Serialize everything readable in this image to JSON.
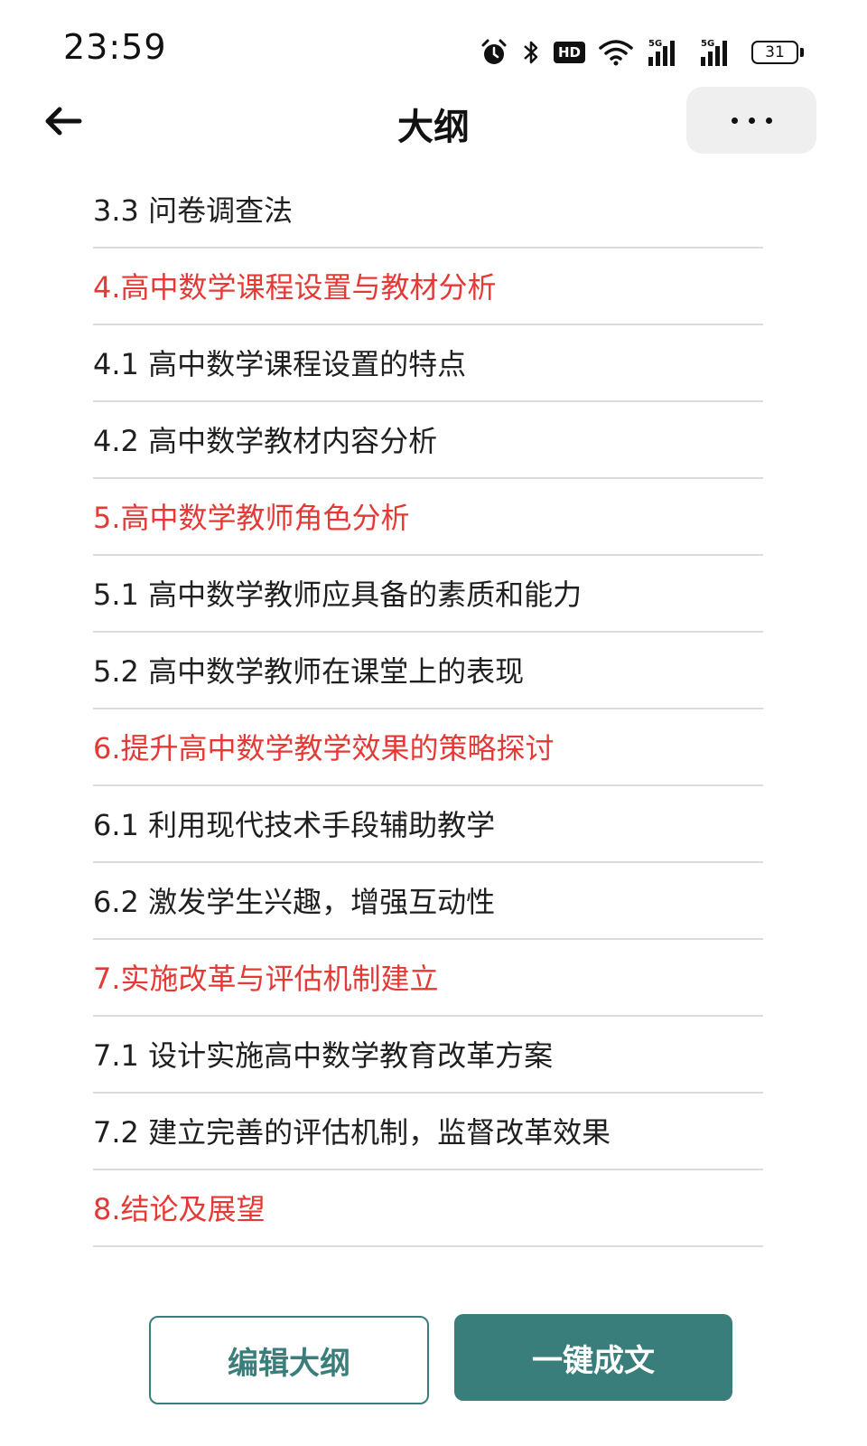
{
  "status_bar": {
    "time": "23:59",
    "hd_label": "HD",
    "signal_label": "5G",
    "battery": "31"
  },
  "header": {
    "title": "大纲"
  },
  "outline": [
    {
      "text": "3.3 问卷调查法",
      "level": "section"
    },
    {
      "text": "4.高中数学课程设置与教材分析",
      "level": "chapter"
    },
    {
      "text": "4.1 高中数学课程设置的特点",
      "level": "section"
    },
    {
      "text": "4.2 高中数学教材内容分析",
      "level": "section"
    },
    {
      "text": "5.高中数学教师角色分析",
      "level": "chapter"
    },
    {
      "text": "5.1 高中数学教师应具备的素质和能力",
      "level": "section"
    },
    {
      "text": "5.2 高中数学教师在课堂上的表现",
      "level": "section"
    },
    {
      "text": "6.提升高中数学教学效果的策略探讨",
      "level": "chapter"
    },
    {
      "text": "6.1 利用现代技术手段辅助教学",
      "level": "section"
    },
    {
      "text": "6.2 激发学生兴趣，增强互动性",
      "level": "section"
    },
    {
      "text": "7.实施改革与评估机制建立",
      "level": "chapter"
    },
    {
      "text": "7.1 设计实施高中数学教育改革方案",
      "level": "section"
    },
    {
      "text": "7.2 建立完善的评估机制，监督改革效果",
      "level": "section"
    },
    {
      "text": "8.结论及展望",
      "level": "chapter"
    }
  ],
  "actions": {
    "edit_label": "编辑大纲",
    "generate_label": "一键成文"
  },
  "colors": {
    "chapter": "#e53935",
    "accent": "#3a7e7b",
    "divider": "#dcdcdc"
  }
}
